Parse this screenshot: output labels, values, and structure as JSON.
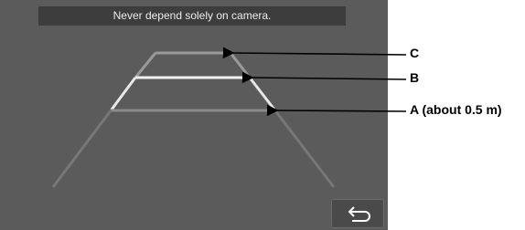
{
  "screen": {
    "warning_text": "Never depend solely on camera.",
    "back_button_icon": "return-arrow-icon"
  },
  "guide_lines": {
    "line_c_color": "#9a9a9a",
    "line_b_color": "#f2f2f2",
    "line_a_color": "#8a8a8a",
    "side_upper_color": "#e8e8e8",
    "side_lower_color": "#777777"
  },
  "callouts": {
    "c_label": "C",
    "b_label": "B",
    "a_label": "A (about 0.5 m)"
  }
}
